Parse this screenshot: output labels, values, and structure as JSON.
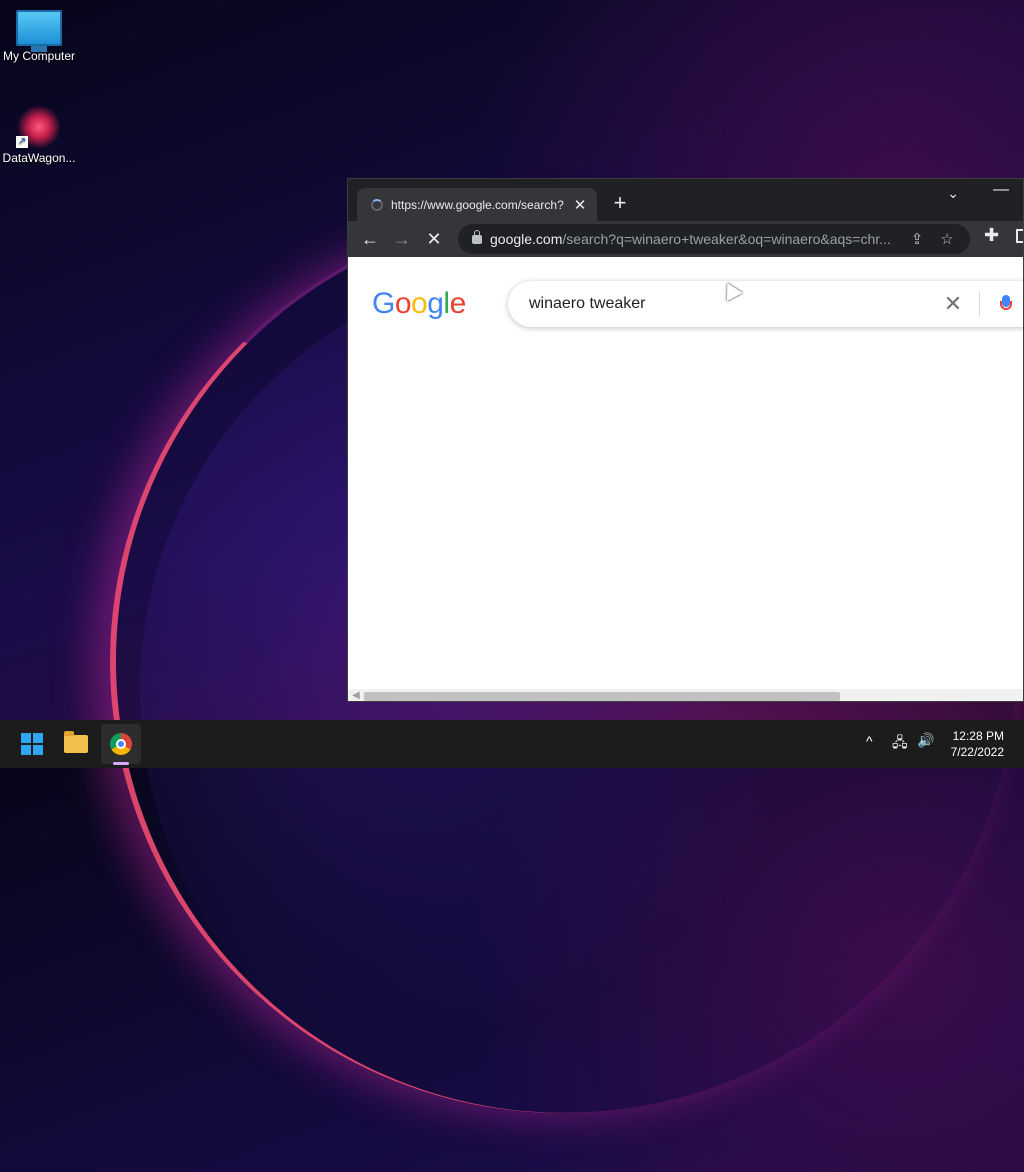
{
  "desktop": {
    "icons": [
      {
        "label": "My Computer",
        "icon": "monitor-icon"
      },
      {
        "label": "DataWagon...",
        "icon": "datawagon-icon"
      }
    ]
  },
  "browser": {
    "tab": {
      "title": "https://www.google.com/search?",
      "close": "✕"
    },
    "new_tab": "+",
    "tab_search": "⌄",
    "minimize": "—",
    "nav": {
      "back": "←",
      "forward": "→",
      "stop": "✕"
    },
    "address": {
      "domain": "google.com",
      "path": "/search?q=winaero+tweaker&oq=winaero&aqs=chr..."
    },
    "page": {
      "logo": [
        "G",
        "o",
        "o",
        "g",
        "l",
        "e"
      ],
      "logo_colors": [
        "#4285f4",
        "#ea4335",
        "#fbbc05",
        "#4285f4",
        "#34a853",
        "#ea4335"
      ],
      "query": "winaero tweaker",
      "clear": "✕",
      "search_glyph": "⌕"
    }
  },
  "taskbar": {
    "apps": [
      "start-icon",
      "file-explorer-icon",
      "chrome-icon"
    ],
    "tray": {
      "chevron": "^",
      "network": "🖧",
      "volume": "🔊"
    },
    "clock": {
      "time": "12:28 PM",
      "date": "7/22/2022"
    }
  }
}
